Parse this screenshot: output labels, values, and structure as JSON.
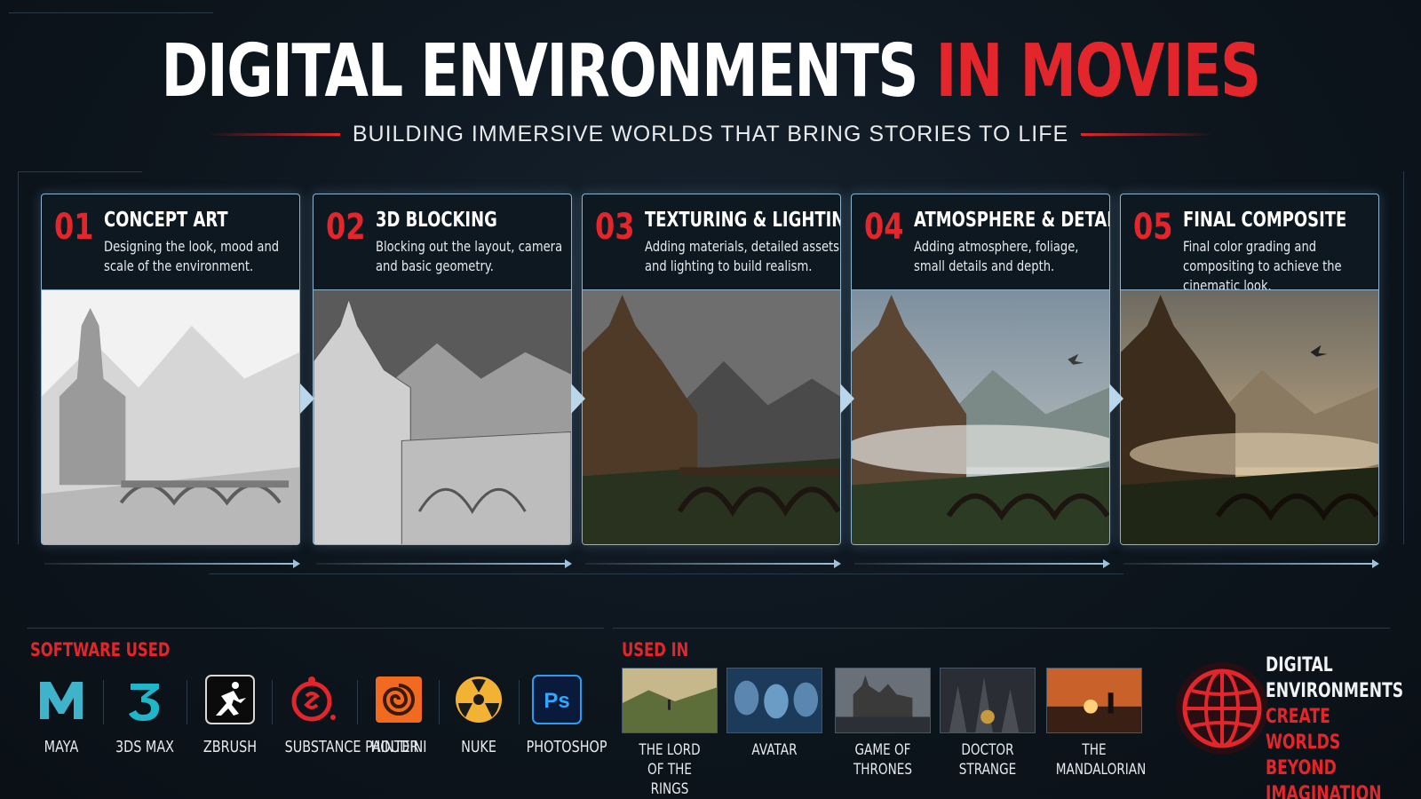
{
  "header": {
    "title_white": "DIGITAL ENVIRONMENTS",
    "title_red": "IN MOVIES",
    "subtitle": "BUILDING IMMERSIVE WORLDS THAT BRING STORIES TO LIFE"
  },
  "steps": [
    {
      "num": "01",
      "title": "CONCEPT ART",
      "desc": "Designing the look, mood and scale of the environment."
    },
    {
      "num": "02",
      "title": "3D BLOCKING",
      "desc": "Blocking out the layout, camera and basic geometry."
    },
    {
      "num": "03",
      "title": "TEXTURING & LIGHTING",
      "desc": "Adding materials, detailed assets and lighting to build realism."
    },
    {
      "num": "04",
      "title": "ATMOSPHERE & DETAIL",
      "desc": "Adding atmosphere, foliage, small details and depth."
    },
    {
      "num": "05",
      "title": "FINAL COMPOSITE",
      "desc": "Final color grading and compositing to achieve the cinematic look."
    }
  ],
  "software": {
    "label": "SOFTWARE USED",
    "items": [
      {
        "name": "MAYA",
        "icon": "maya-icon"
      },
      {
        "name": "3DS MAX",
        "icon": "3dsmax-icon"
      },
      {
        "name": "ZBRUSH",
        "icon": "zbrush-icon"
      },
      {
        "name": "SUBSTANCE PAINTER",
        "icon": "substance-painter-icon"
      },
      {
        "name": "HOUDINI",
        "icon": "houdini-icon"
      },
      {
        "name": "NUKE",
        "icon": "nuke-icon"
      },
      {
        "name": "PHOTOSHOP",
        "icon": "photoshop-icon"
      }
    ]
  },
  "used_in": {
    "label": "USED IN",
    "items": [
      {
        "name": "THE LORD OF THE RINGS"
      },
      {
        "name": "AVATAR"
      },
      {
        "name": "GAME OF THRONES"
      },
      {
        "name": "DOCTOR STRANGE"
      },
      {
        "name": "THE MANDALORIAN"
      }
    ]
  },
  "tagline": {
    "line1": "DIGITAL",
    "line2": "ENVIRONMENTS",
    "line3": "CREATE WORLDS",
    "line4": "BEYOND",
    "line5": "IMAGINATION"
  },
  "colors": {
    "accent": "#e3262c",
    "frame": "#8fb3cc",
    "background": "#0d151d"
  }
}
